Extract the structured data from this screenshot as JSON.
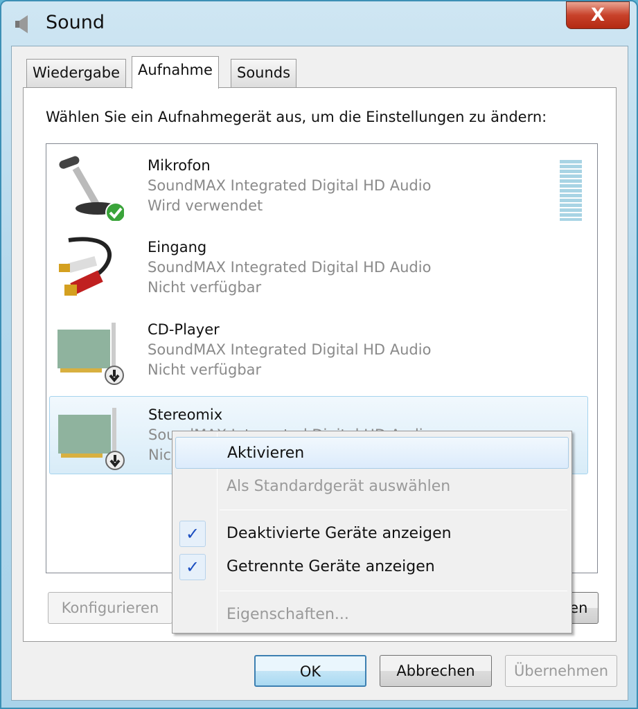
{
  "window": {
    "title": "Sound",
    "close_label": "X"
  },
  "tabs": [
    {
      "label": "Wiedergabe"
    },
    {
      "label": "Aufnahme",
      "active": true
    },
    {
      "label": "Sounds"
    }
  ],
  "instruction": "Wählen Sie ein Aufnahmegerät aus, um die Einstellungen zu ändern:",
  "devices": [
    {
      "name": "Mikrofon",
      "driver": "SoundMAX Integrated Digital HD Audio",
      "status": "Wird verwendet",
      "icon": "microphone-icon",
      "badge": "green-check-icon"
    },
    {
      "name": "Eingang",
      "driver": "SoundMAX Integrated Digital HD Audio",
      "status": "Nicht verfügbar",
      "icon": "rca-cable-icon"
    },
    {
      "name": "CD-Player",
      "driver": "SoundMAX Integrated Digital HD Audio",
      "status": "Nicht verfügbar",
      "icon": "sound-card-icon",
      "badge": "down-arrow-icon"
    },
    {
      "name": "Stereomix",
      "driver": "SoundMAX Integrated Digital HD Audio",
      "status": "Nicht verfügbar",
      "icon": "sound-card-icon",
      "badge": "down-arrow-icon",
      "selected": true
    }
  ],
  "panel_buttons": {
    "configure": "Konfigurieren",
    "properties": "Eigenschaften"
  },
  "context_menu": [
    {
      "label": "Aktivieren",
      "highlighted": true
    },
    {
      "label": "Als Standardgerät auswählen",
      "disabled": true
    },
    {
      "label": "Deaktivierte Geräte anzeigen",
      "checked": true
    },
    {
      "label": "Getrennte Geräte anzeigen",
      "checked": true
    },
    {
      "label": "Eigenschaften...",
      "disabled": true
    }
  ],
  "check_glyph": "✓",
  "dialog_buttons": {
    "ok": "OK",
    "cancel": "Abbrechen",
    "apply": "Übernehmen"
  }
}
